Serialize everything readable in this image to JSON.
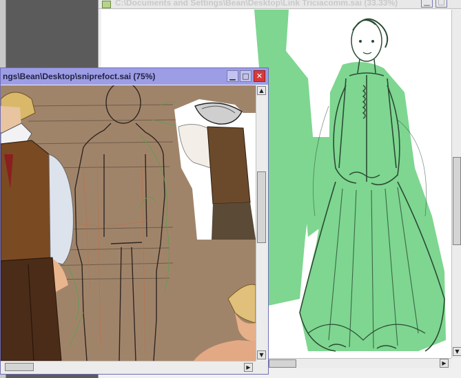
{
  "windows": {
    "back": {
      "title": "C:\\Documents and Settings\\Bean\\Desktop\\Link Triciacomm.sai (33.33%)",
      "minimize_glyph": "▁",
      "maximize_glyph": "□"
    },
    "front": {
      "title": "ngs\\Bean\\Desktop\\sniprefoct.sai (75%)",
      "minimize_glyph": "▁",
      "maximize_glyph": "□",
      "close_glyph": "✕"
    }
  },
  "scrollbars": {
    "up_glyph": "▲",
    "down_glyph": "▼",
    "left_glyph": "◀",
    "right_glyph": "▶"
  },
  "colors": {
    "front_title_bg": "#9d9de6",
    "back_title_bg": "#e8e8e8",
    "close_button": "#d83a3a",
    "canvas_tan": "#a0846a",
    "green_flat": "#7ed690",
    "sketch_stroke": "#2b4a33"
  }
}
